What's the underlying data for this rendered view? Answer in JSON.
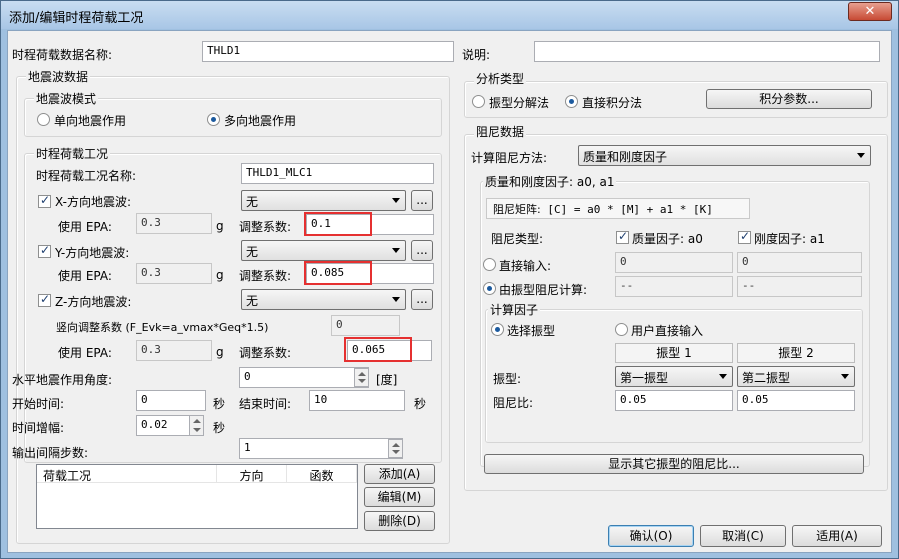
{
  "window": {
    "title": "添加/编辑时程荷载工况",
    "close_label": "✕"
  },
  "general": {
    "name_label": "时程荷载数据名称:",
    "name_value": "THLD1",
    "desc_label": "说明:",
    "desc_value": ""
  },
  "seismic": {
    "group_title": "地震波数据",
    "mode_group_title": "地震波模式",
    "mode_single_label": "单向地震作用",
    "mode_multi_label": "多向地震作用",
    "mode_selected": "multi"
  },
  "load_case": {
    "group_title": "时程荷载工况",
    "case_name_label": "时程荷载工况名称:",
    "case_name_value": "THLD1_MLC1",
    "x": {
      "label": "X-方向地震波:",
      "checked": true,
      "wave": "无",
      "epa_label": "使用 EPA:",
      "epa_value": "0.3",
      "unit": "g",
      "factor_label": "调整系数:",
      "factor_value": "0.1"
    },
    "y": {
      "label": "Y-方向地震波:",
      "checked": true,
      "wave": "无",
      "epa_label": "使用 EPA:",
      "epa_value": "0.3",
      "unit": "g",
      "factor_label": "调整系数:",
      "factor_value": "0.085"
    },
    "z": {
      "label": "Z-方向地震波:",
      "checked": true,
      "wave": "无",
      "vert_label": "竖向调整系数 (F_Evk=a_vmax*Geq*1.5)",
      "vert_value": "0",
      "epa_label": "使用 EPA:",
      "epa_value": "0.3",
      "unit": "g",
      "factor_label": "调整系数:",
      "factor_value": "0.065"
    },
    "ellipsis_label": "..."
  },
  "params": {
    "angle_label": "水平地震作用角度:",
    "angle_value": "0",
    "angle_unit": "[度]",
    "start_label": "开始时间:",
    "start_value": "0",
    "start_unit": "秒",
    "end_label": "结束时间:",
    "end_value": "10",
    "end_unit": "秒",
    "step_label": "时间增幅:",
    "step_value": "0.02",
    "step_unit": "秒",
    "output_label": "输出间隔步数:",
    "output_value": "1"
  },
  "table": {
    "headers": [
      "荷载工况",
      "方向",
      "函数"
    ],
    "rows": []
  },
  "table_buttons": {
    "add": "添加(A)",
    "edit": "编辑(M)",
    "delete": "删除(D)"
  },
  "analysis": {
    "group_title": "分析类型",
    "modal_label": "振型分解法",
    "direct_label": "直接积分法",
    "selected": "direct",
    "integ_button": "积分参数..."
  },
  "damping": {
    "group_title": "阻尼数据",
    "method_label": "计算阻尼方法:",
    "method_value": "质量和刚度因子",
    "factor_group_title": "质量和刚度因子: a0, a1",
    "matrix_label": "阻尼矩阵:",
    "matrix_value": "[C] = a0 * [M] + a1 * [K]",
    "type_label": "阻尼类型:",
    "mass_label": "质量因子: a0",
    "mass_checked": true,
    "stiff_label": "刚度因子: a1",
    "stiff_checked": true,
    "direct_label": "直接输入:",
    "direct_a0": "0",
    "direct_a1": "0",
    "modal_label": "由振型阻尼计算:",
    "modal_a0": "--",
    "modal_a1": "--",
    "calc_selected": "modal",
    "calc_group_title": "计算因子",
    "select_mode_label": "选择振型",
    "user_input_label": "用户直接输入",
    "calc_mode": "select",
    "mode1_header": "振型 1",
    "mode2_header": "振型 2",
    "mode_label": "振型:",
    "mode1_value": "第一振型",
    "mode2_value": "第二振型",
    "ratio_label": "阻尼比:",
    "ratio1_value": "0.05",
    "ratio2_value": "0.05",
    "show_other_button": "显示其它振型的阻尼比..."
  },
  "footer": {
    "ok": "确认(O)",
    "cancel": "取消(C)",
    "apply": "适用(A)"
  }
}
